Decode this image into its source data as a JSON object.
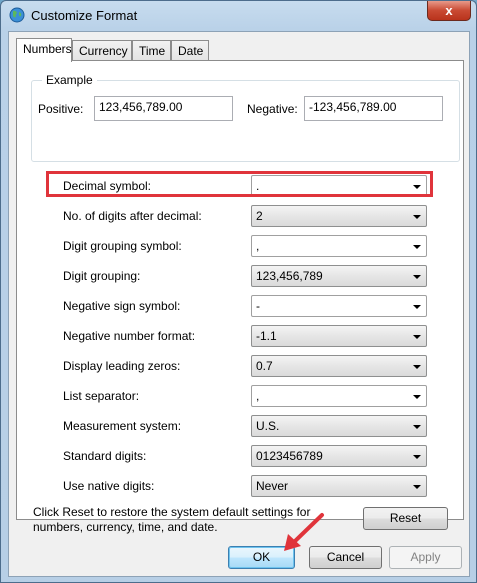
{
  "window": {
    "title": "Customize Format",
    "close_glyph": "x",
    "icon": "globe-icon"
  },
  "tabs": [
    {
      "label": "Numbers",
      "active": true
    },
    {
      "label": "Currency",
      "active": false
    },
    {
      "label": "Time",
      "active": false
    },
    {
      "label": "Date",
      "active": false
    }
  ],
  "example": {
    "group_label": "Example",
    "positive_label": "Positive:",
    "positive_value": "123,456,789.00",
    "negative_label": "Negative:",
    "negative_value": "-123,456,789.00"
  },
  "settings": [
    {
      "label": "Decimal symbol:",
      "value": ".",
      "readonly": false
    },
    {
      "label": "No. of digits after decimal:",
      "value": "2",
      "readonly": true
    },
    {
      "label": "Digit grouping symbol:",
      "value": ",",
      "readonly": false
    },
    {
      "label": "Digit grouping:",
      "value": "123,456,789",
      "readonly": true
    },
    {
      "label": "Negative sign symbol:",
      "value": "-",
      "readonly": false
    },
    {
      "label": "Negative number format:",
      "value": "-1.1",
      "readonly": true
    },
    {
      "label": "Display leading zeros:",
      "value": "0.7",
      "readonly": true
    },
    {
      "label": "List separator:",
      "value": ",",
      "readonly": false
    },
    {
      "label": "Measurement system:",
      "value": "U.S.",
      "readonly": true
    },
    {
      "label": "Standard digits:",
      "value": "0123456789",
      "readonly": true
    },
    {
      "label": "Use native digits:",
      "value": "Never",
      "readonly": true
    }
  ],
  "footer": {
    "reset_text": "Click Reset to restore the system default settings for numbers, currency, time, and date.",
    "reset_button": "Reset"
  },
  "buttons": {
    "ok": "OK",
    "cancel": "Cancel",
    "apply": "Apply"
  },
  "colors": {
    "highlight": "#e0343b",
    "arrow": "#e0343b"
  }
}
